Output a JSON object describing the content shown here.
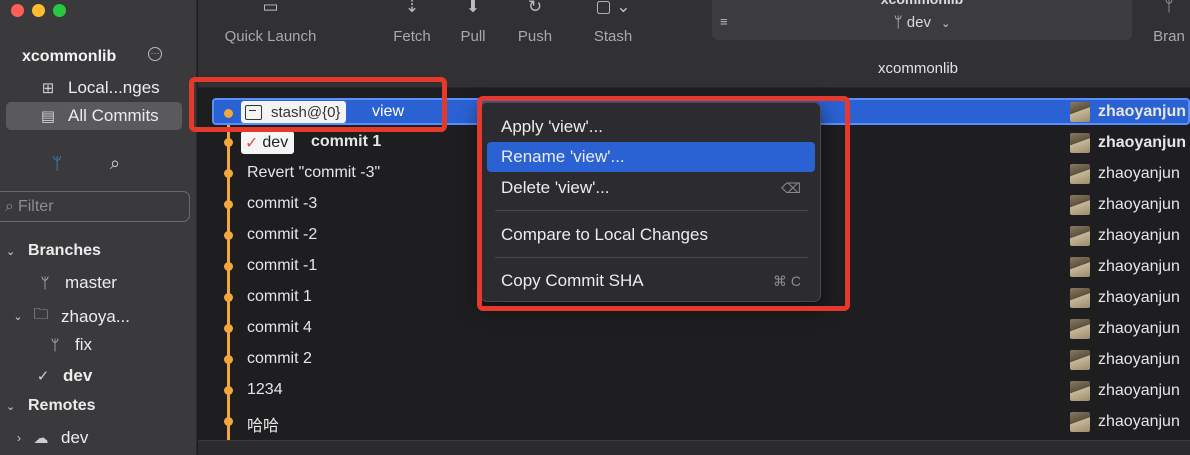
{
  "sidebar": {
    "repo_name": "xcommonlib",
    "nav": [
      {
        "label": "Local...nges"
      },
      {
        "label": "All Commits"
      }
    ],
    "filter_placeholder": "Filter",
    "branches_header": "Branches",
    "branches": [
      {
        "label": "master"
      },
      {
        "label": "zhaoya..."
      },
      {
        "label": "fix"
      },
      {
        "label": "dev"
      }
    ],
    "remotes_header": "Remotes",
    "remotes": [
      {
        "label": "dev"
      }
    ]
  },
  "toolbar": {
    "quick_launch": "Quick Launch",
    "fetch": "Fetch",
    "pull": "Pull",
    "push": "Push",
    "stash": "Stash",
    "repo_title": "xcommonlib",
    "current_branch": "dev",
    "branch_button": "Bran"
  },
  "title_strip": "xcommonlib",
  "commits": [
    {
      "stash_label": "stash@{0}",
      "message": "view",
      "author": "zhaoyanjun"
    },
    {
      "badge": "dev",
      "message": "commit 1",
      "author": "zhaoyanjun"
    },
    {
      "message": "Revert \"commit -3\"",
      "author": "zhaoyanjun"
    },
    {
      "message": "commit -3",
      "author": "zhaoyanjun"
    },
    {
      "message": "commit -2",
      "author": "zhaoyanjun"
    },
    {
      "message": "commit -1",
      "author": "zhaoyanjun"
    },
    {
      "message": "commit 1",
      "author": "zhaoyanjun"
    },
    {
      "message": "commit 4",
      "author": "zhaoyanjun"
    },
    {
      "message": "commit 2",
      "author": "zhaoyanjun"
    },
    {
      "message": "1234",
      "author": "zhaoyanjun"
    },
    {
      "message": "哈哈",
      "author": "zhaoyanjun"
    }
  ],
  "context_menu": {
    "apply": "Apply 'view'...",
    "rename": "Rename 'view'...",
    "delete": "Delete 'view'...",
    "compare": "Compare to Local Changes",
    "copy_sha": "Copy Commit SHA",
    "copy_sha_shortcut": "⌘ C"
  },
  "colors": {
    "accent_blue": "#2a62d3",
    "graph_orange": "#f4a73a",
    "highlight_red": "#e5392b"
  }
}
